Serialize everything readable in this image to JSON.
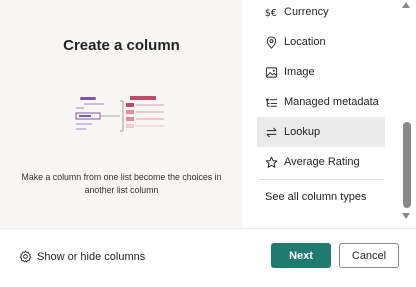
{
  "preview": {
    "title": "Create a column",
    "description": "Make a column from one list become the choices in another list column"
  },
  "column_types": [
    {
      "label": "Currency",
      "icon": "currency-icon"
    },
    {
      "label": "Location",
      "icon": "location-pin-icon"
    },
    {
      "label": "Image",
      "icon": "image-icon"
    },
    {
      "label": "Managed metadata",
      "icon": "managed-metadata-icon"
    },
    {
      "label": "Lookup",
      "icon": "lookup-arrows-icon",
      "selected": true
    },
    {
      "label": "Average Rating",
      "icon": "star-icon"
    }
  ],
  "see_all_label": "See all column types",
  "footer": {
    "show_hide_label": "Show or hide columns",
    "next_label": "Next",
    "cancel_label": "Cancel"
  },
  "colors": {
    "accent": "#1f7a6f",
    "selected_bg": "#ebebeb",
    "panel_bg": "#f8f7f5",
    "illustration_pink": "#c14a64"
  }
}
